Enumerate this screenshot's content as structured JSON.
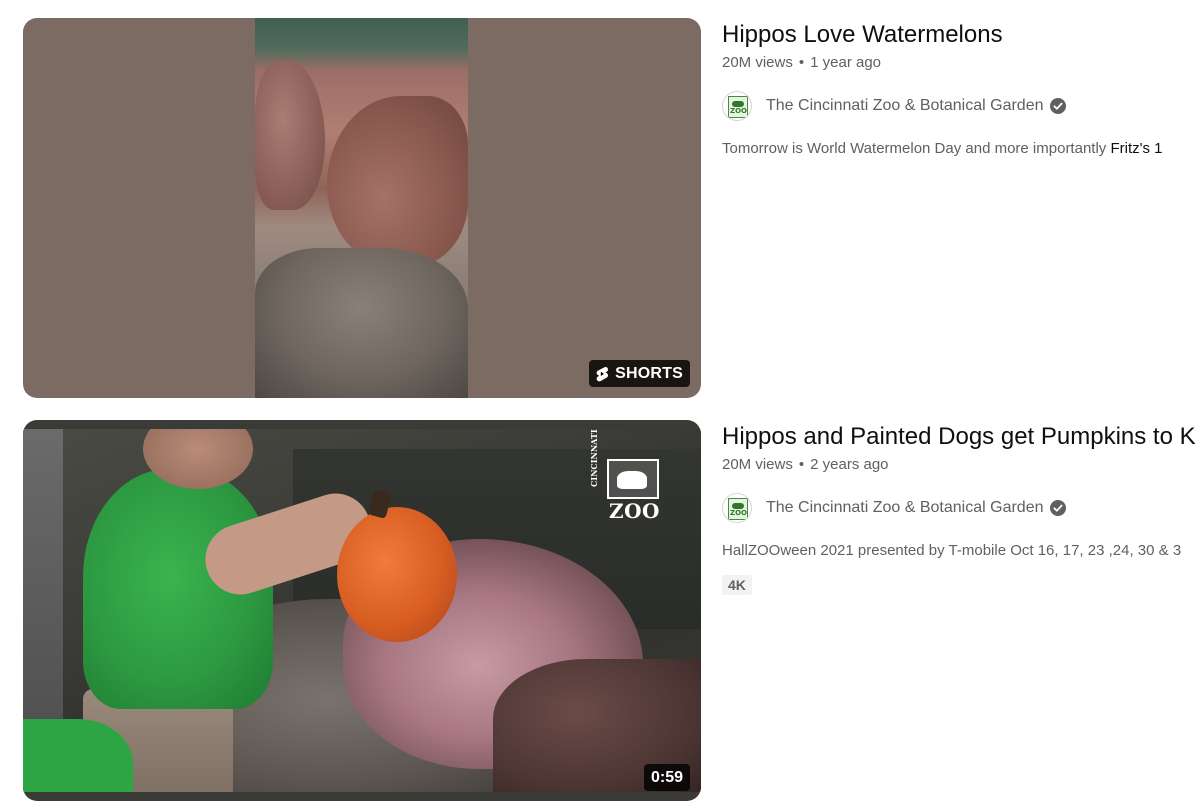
{
  "videos": [
    {
      "title": "Hippos Love Watermelons",
      "views": "20M views",
      "age": "1 year ago",
      "channel": "The Cincinnati Zoo & Botanical Garden",
      "description_prefix": "Tomorrow is World Watermelon Day and more importantly ",
      "description_bold": "Fritz's 1",
      "badge": "SHORTS"
    },
    {
      "title": "Hippos and Painted Dogs get Pumpkins to K",
      "views": "20M views",
      "age": "2 years ago",
      "channel": "The Cincinnati Zoo & Botanical Garden",
      "description": "HallZOOween 2021 presented by T-mobile Oct 16, 17, 23 ,24, 30 & 3",
      "quality_tag": "4K",
      "duration": "0:59"
    }
  ],
  "thumbnail_logo": {
    "word": "ZOO",
    "vertical": "CINCINNATI"
  },
  "avatar_text": "ZOO",
  "meta_separator": "•",
  "colors": {
    "title": "#0f0f0f",
    "meta": "#606060",
    "badge_bg": "#000000",
    "shirt_green": "#2d9a41",
    "pumpkin": "#d85e22"
  },
  "icons": [
    "shorts-icon",
    "verified-check-icon",
    "channel-avatar-icon"
  ]
}
